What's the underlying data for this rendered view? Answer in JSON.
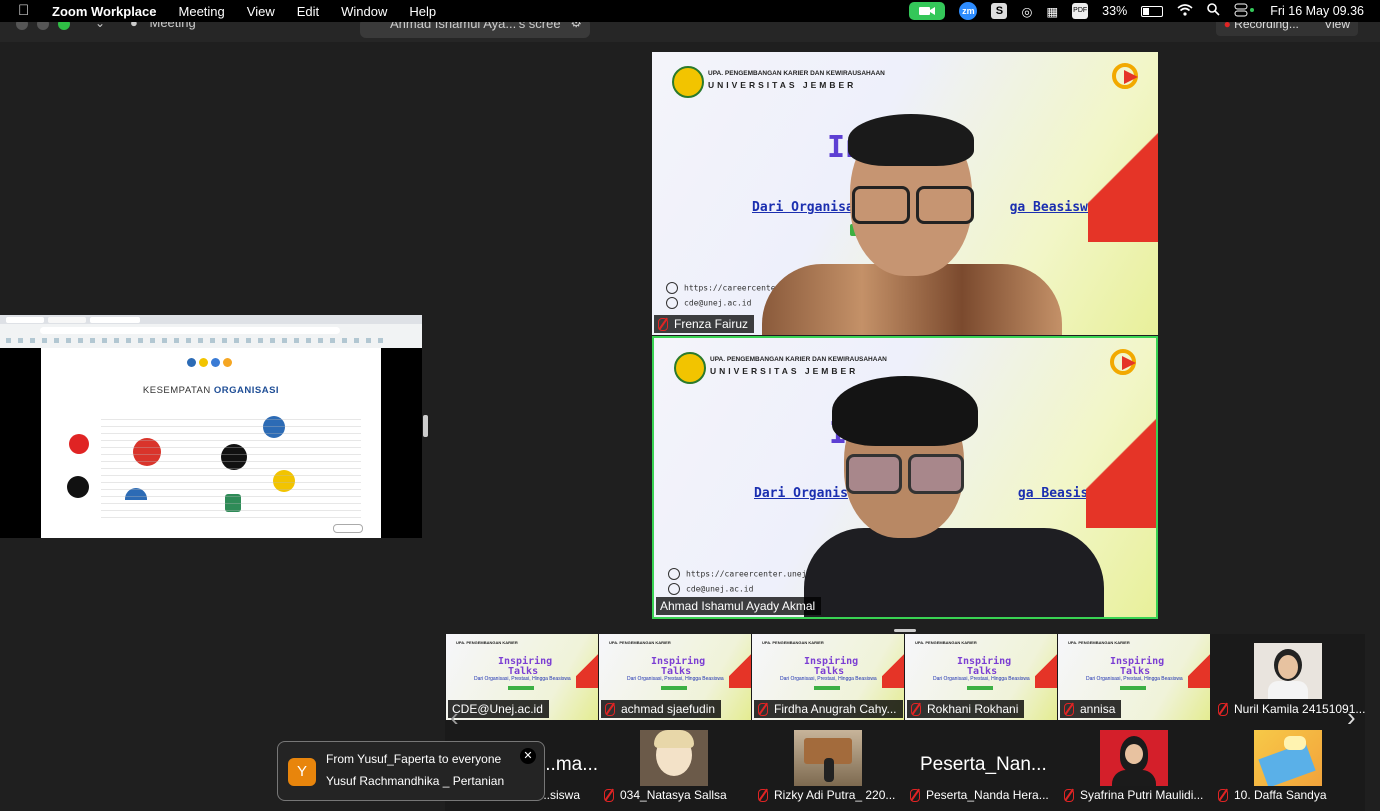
{
  "menubar": {
    "app_name": "Zoom Workplace",
    "items": [
      "Meeting",
      "View",
      "Edit",
      "Window",
      "Help"
    ],
    "battery": "33%",
    "datetime": "Fri 16 May  09.36"
  },
  "toolbar": {
    "meeting_label": "Meeting",
    "share_tab": "Ahmad Ishamul Aya...'s scree",
    "recording": "Recording...",
    "view": "View"
  },
  "shared_screen": {
    "slide_title_a": "KESEMPATAN ",
    "slide_title_b": "ORGANISASI"
  },
  "video_tiles": [
    {
      "name": "Frenza Fairuz",
      "org_top": "UPA. PENGEMBANGAN KARIER DAN KEWIRAUSAHAAN",
      "org_bottom": "UNIVERSITAS JEMBER",
      "title_part": "In        g",
      "subtitle_a": "Dari Organisas",
      "subtitle_b": "ga Beasiswa",
      "url": "https://careercenter.unej.ac.id",
      "email": "cde@unej.ac.id",
      "active": false
    },
    {
      "name": "Ahmad Ishamul Ayady Akmal",
      "org_top": "UPA. PENGEMBANGAN KARIER DAN KEWIRAUSAHAAN",
      "org_bottom": "UNIVERSITAS JEMBER",
      "title_part": "I",
      "subtitle_a": "Dari Organis",
      "subtitle_b": "ga Beasiswa",
      "url": "https://careercenter.unej.ac.id",
      "email": "cde@unej.ac.id",
      "active": true
    }
  ],
  "participants_row1": [
    {
      "name": "CDE@Unej.ac.id"
    },
    {
      "name": "achmad sjaefudin"
    },
    {
      "name": "Firdha Anugrah Cahy..."
    },
    {
      "name": "Rokhani Rokhani"
    },
    {
      "name": "annisa"
    },
    {
      "name": "Nuril Kamila 24151091..."
    }
  ],
  "thumb_text": {
    "inspiring": "Inspiring",
    "talks": "Talks",
    "sub": "Dari Organisasi, Prestasi, Hingga Beasiswa"
  },
  "participants_row2": [
    {
      "name": "...siswa",
      "big": "...ma..."
    },
    {
      "name": "034_Natasya Sallsa"
    },
    {
      "name": "Rizky Adi Putra_ 220..."
    },
    {
      "name": "Peserta_Nanda Hera...",
      "big": "Peserta_Nan..."
    },
    {
      "name": "Syafrina Putri Maulidi..."
    },
    {
      "name": "10. Daffa Sandya"
    }
  ],
  "chat_toast": {
    "initial": "Y",
    "from": "From Yusuf_Faperta to everyone",
    "message": "Yusuf Rachmandhika _ Pertanian"
  },
  "colors": {
    "active_border": "#39d353",
    "mic_off": "#e02424",
    "avatar_bg": "#e8850c"
  }
}
